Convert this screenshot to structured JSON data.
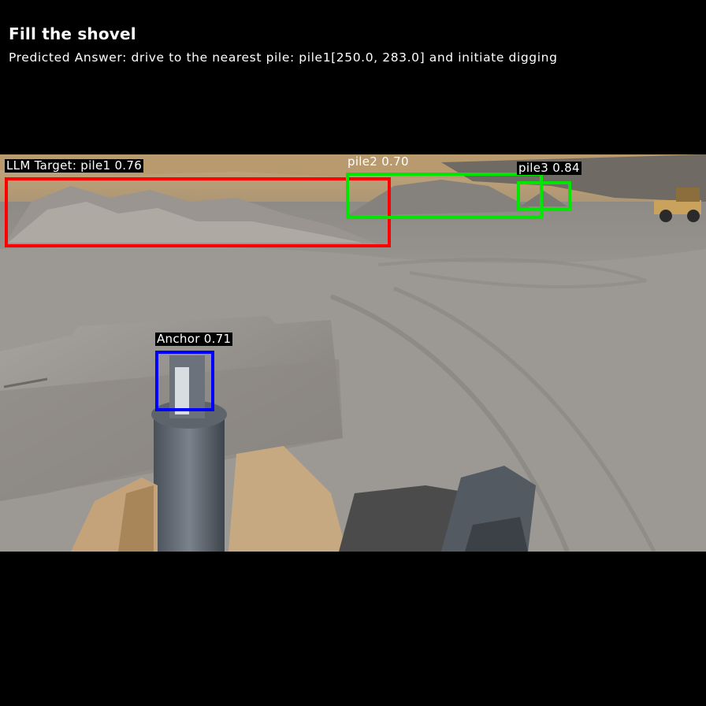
{
  "header": {
    "title": "Fill the shovel",
    "predicted_answer": "Predicted Answer: drive to the nearest pile: pile1[250.0, 283.0] and initiate digging"
  },
  "detections": {
    "llm_target": {
      "label": "LLM Target: pile1 0.76",
      "color": "#ff0000"
    },
    "pile2": {
      "label": "pile2 0.70",
      "color": "#00e600"
    },
    "pile3": {
      "label": "pile3 0.84",
      "color": "#00e600"
    },
    "anchor": {
      "label": "Anchor 0.71",
      "color": "#0000ff"
    }
  }
}
